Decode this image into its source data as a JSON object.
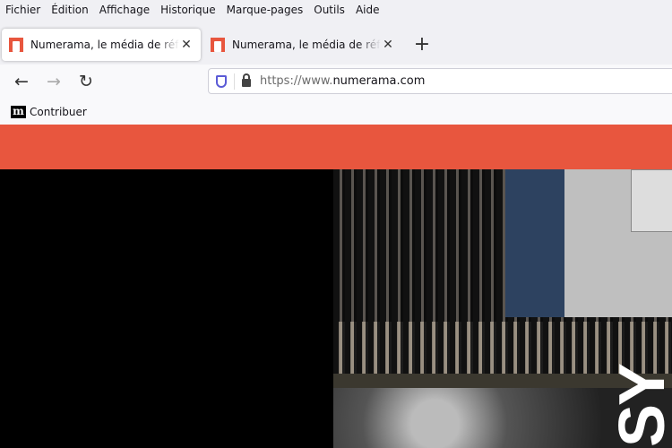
{
  "menu": [
    "Fichier",
    "Édition",
    "Affichage",
    "Historique",
    "Marque-pages",
    "Outils",
    "Aide"
  ],
  "tabs": [
    {
      "title": "Numerama, le média de référence",
      "active": true
    },
    {
      "title": "Numerama, le média de référence",
      "active": false
    }
  ],
  "nav": {
    "back": "←",
    "forward": "→",
    "reload": "↻",
    "url_prefix": "https://www.",
    "url_domain": "numerama.com"
  },
  "bookmarks": [
    {
      "icon": "m",
      "label": "Contribuer"
    }
  ],
  "colors": {
    "brand": "#e8563e"
  },
  "ad": {
    "text": "SY"
  }
}
